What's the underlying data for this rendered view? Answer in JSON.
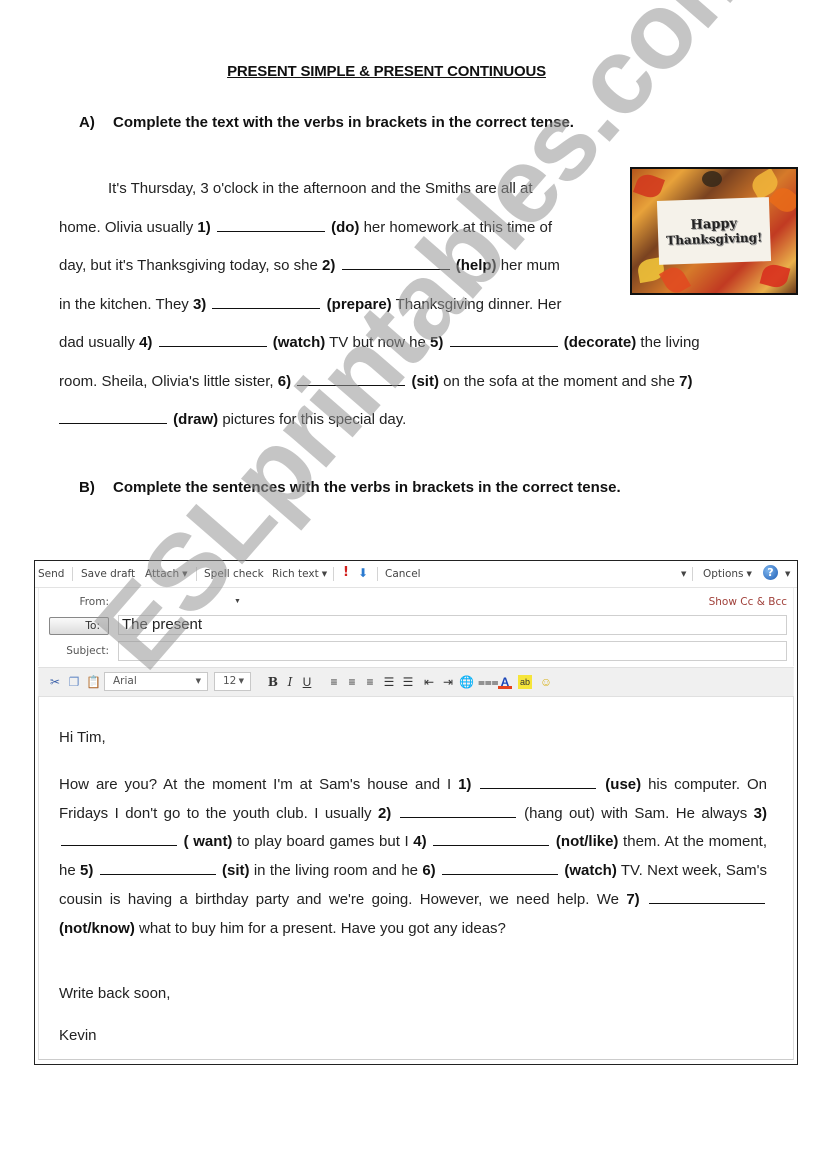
{
  "worksheet": {
    "title": "PRESENT SIMPLE & PRESENT CONTINUOUS",
    "task_a": {
      "letter": "A)",
      "instruction": "Complete the text with the verbs in brackets in the correct tense."
    },
    "text_a": {
      "l1": "It's Thursday, 3 o'clock in the afternoon and the Smiths are all at",
      "l2a": "home. Olivia usually ",
      "n1": "1)",
      "v1": "(do)",
      "l2b": " her homework at this time of",
      "l3a": "day, but it's Thanksgiving today, so she ",
      "n2": "2)",
      "v2": "(help)",
      "l3b": " her mum",
      "l4a": "in the kitchen. They  ",
      "n3": "3)",
      "v3": "(prepare)",
      "l4b": " Thanksgiving dinner. Her",
      "l5a": "dad usually ",
      "n4": "4)",
      "v4": "(watch)",
      "l5b": " TV but now he ",
      "n5": "5)",
      "v5": "(decorate)",
      "l5c": " the living",
      "l6a": "room. Sheila,  Olivia's little sister, ",
      "n6": "6)",
      "v6": "(sit)",
      "l6b": " on the sofa at the moment and she ",
      "n7": "7)",
      "v7": "(draw)",
      "l7b": " pictures for this special day."
    },
    "image": {
      "line1": "Happy",
      "line2": "Thanksgiving!"
    },
    "task_b": {
      "letter": "B)",
      "instruction": "Complete the sentences with the verbs in brackets in the correct tense."
    }
  },
  "email": {
    "toolbar": {
      "send": "Send",
      "save_draft": "Save draft",
      "attach": "Attach",
      "spell_check": "Spell check",
      "rich_text": "Rich text",
      "cancel": "Cancel",
      "options": "Options",
      "importance_high_icon": "!",
      "importance_low_icon": "⬇",
      "help_icon": "?",
      "caret": "▼"
    },
    "header": {
      "from_label": "From:",
      "from_value": "",
      "to_button": "To:",
      "to_value": "The present",
      "subject_label": "Subject:",
      "subject_value": "",
      "show_cc_bcc": "Show Cc & Bcc"
    },
    "format": {
      "font": "Arial",
      "size": "12",
      "bold": "B",
      "italic": "I",
      "underline": "U"
    },
    "body": {
      "greeting": "Hi Tim,",
      "s1": "How are you? At the moment I'm at Sam's house and I ",
      "n1": "1)",
      "v1": "(use)",
      "s1b": " his computer. On Fridays I don't go to the youth club. I usually ",
      "n2": "2)",
      "v2": "(hang out)",
      "s2b": " with Sam. He always ",
      "n3": "3)",
      "v3": "( want)",
      "s3b": " to play board games but I ",
      "n4": "4)",
      "v4": "(not/like)",
      "s4b": " them. At the moment, he ",
      "n5": "5)",
      "v5": "(sit)",
      "s5b": " in the living room and he ",
      "n6": "6)",
      "v6": "(watch)",
      "s6b": " TV. Next week, Sam's cousin is having a birthday party and we're going. However, we need help. We ",
      "n7": "7)",
      "v7": "(not/know)",
      "s7b": " what to buy him for a present. Have you got any ideas?",
      "closing": "Write back soon,",
      "signature": "Kevin"
    }
  },
  "watermark": "ESLprintables.com"
}
